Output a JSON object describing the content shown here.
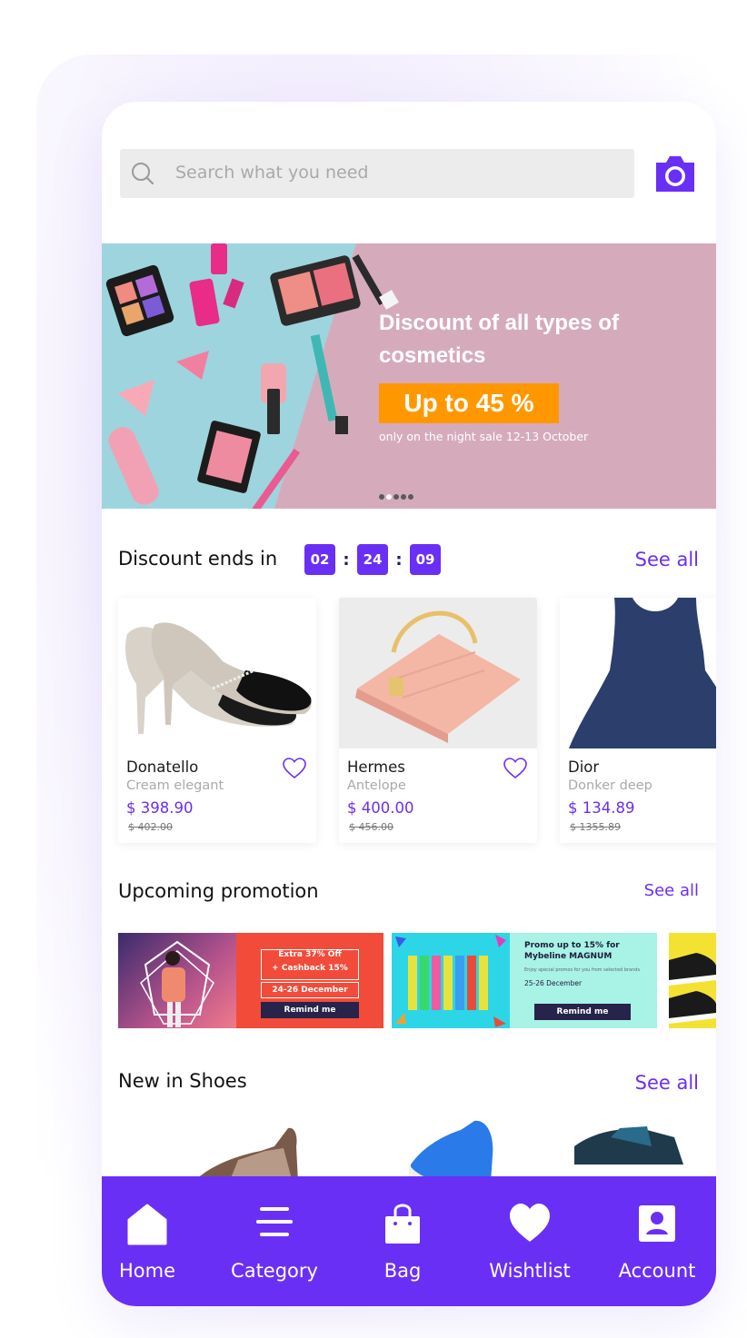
{
  "search": {
    "placeholder": "Search what you need"
  },
  "hero": {
    "headline": "Discount of all types of cosmetics",
    "badge": "Up to 45 %",
    "subtext": "only on the night sale 12-13 October",
    "slide_count": 5,
    "active_slide": 2
  },
  "discount_section": {
    "title": "Discount ends in",
    "timer": {
      "hours": "02",
      "minutes": "24",
      "seconds": "09"
    },
    "see_all": "See all",
    "products": [
      {
        "brand": "Donatello",
        "model": "Cream elegant",
        "price": "$ 398.90",
        "old_price": "$ 402.00"
      },
      {
        "brand": "Hermes",
        "model": "Antelope",
        "price": "$ 400.00",
        "old_price": "$ 456.00"
      },
      {
        "brand": "Dior",
        "model": "Donker deep",
        "price": "$ 134.89",
        "old_price": "$ 1355.89"
      }
    ]
  },
  "promotion_section": {
    "title": "Upcoming promotion",
    "see_all": "See all",
    "promos": [
      {
        "line1": "Extra 37% Off",
        "line2": "+ Cashback 15%",
        "date": "24-26 December",
        "button": "Remind me"
      },
      {
        "title": "Promo up to 15% for Mybeline MAGNUM",
        "desc": "Enjoy special promos for you from selected brands",
        "date": "25-26 December",
        "button": "Remind me"
      }
    ]
  },
  "shoes_section": {
    "title": "New in Shoes",
    "see_all": "See all"
  },
  "tabbar": {
    "items": [
      {
        "label": "Home",
        "icon": "home-icon"
      },
      {
        "label": "Category",
        "icon": "category-icon"
      },
      {
        "label": "Bag",
        "icon": "bag-icon"
      },
      {
        "label": "Wishtlist",
        "icon": "heart-icon"
      },
      {
        "label": "Account",
        "icon": "account-icon"
      }
    ]
  },
  "colors": {
    "accent": "#6a2ff5",
    "badge": "#ff9800",
    "promo_red": "#f24b3a",
    "promo_mint": "#a8f2e6"
  }
}
